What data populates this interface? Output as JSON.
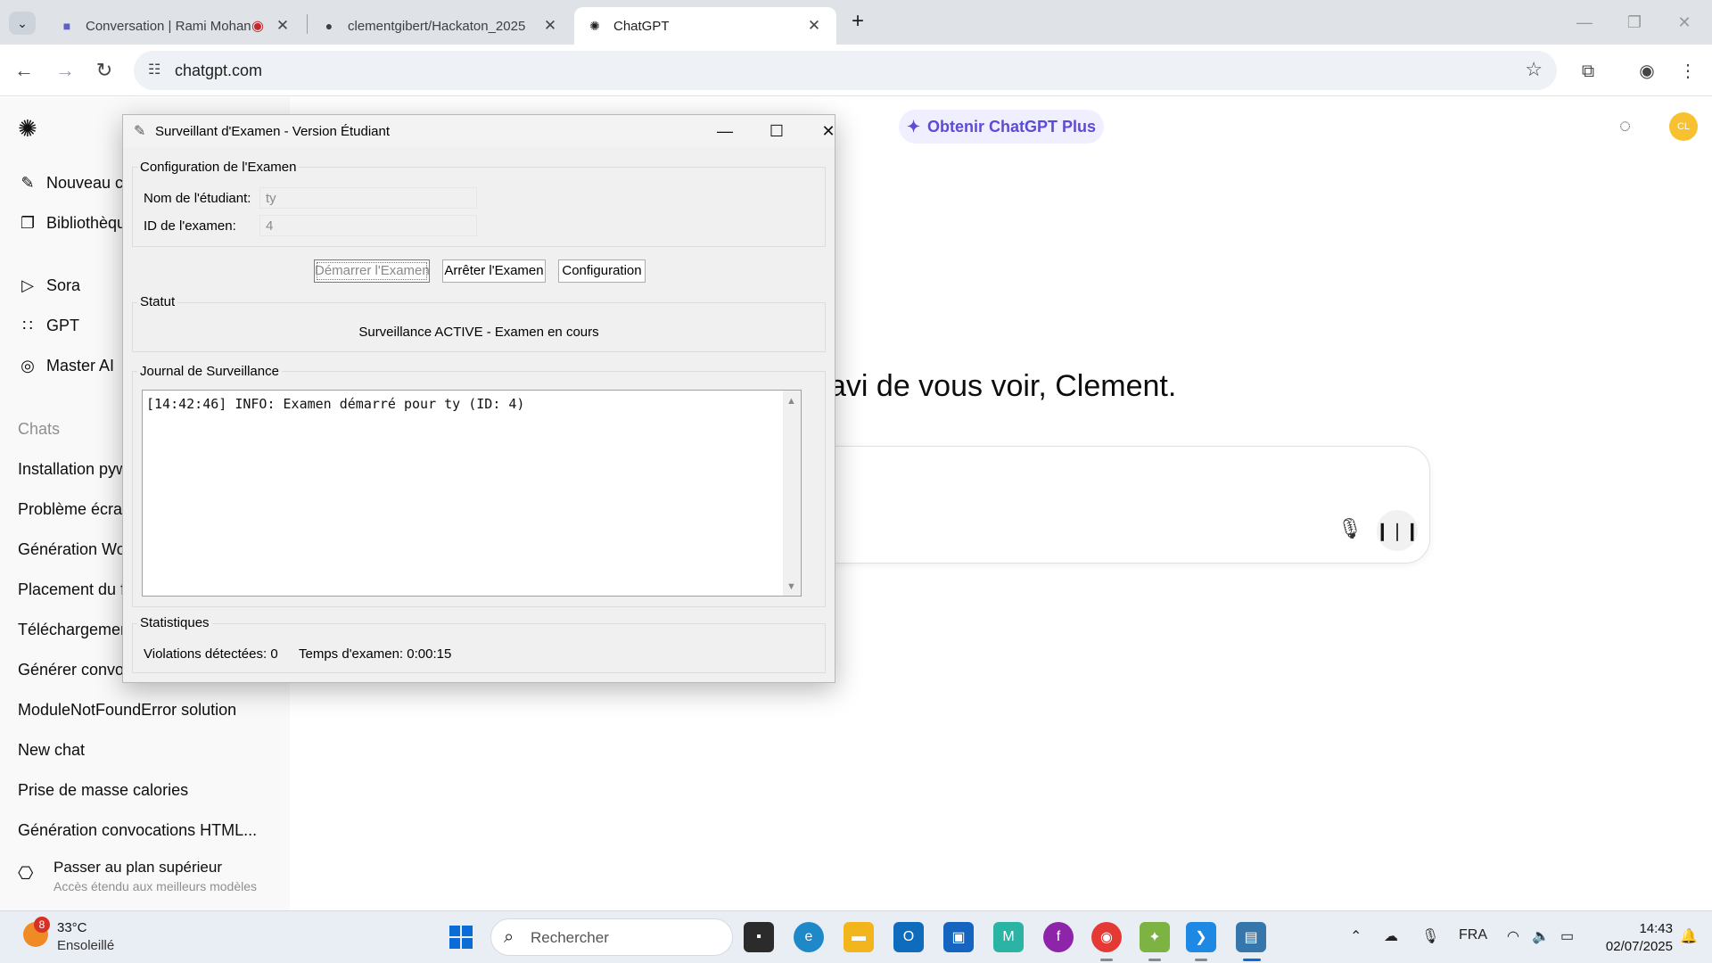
{
  "browser": {
    "tabs": [
      {
        "title": "Conversation | Rami Mohan",
        "icon": "teams-icon"
      },
      {
        "title": "clementgibert/Hackaton_2025",
        "icon": "github-icon"
      },
      {
        "title": "ChatGPT",
        "icon": "openai-icon"
      }
    ],
    "url": "chatgpt.com"
  },
  "sidebar": {
    "nav": [
      {
        "label": "Nouveau c",
        "icon": "edit-icon"
      },
      {
        "label": "Bibliothèqu",
        "icon": "library-icon"
      },
      {
        "label": "Sora",
        "icon": "play-circle-icon"
      },
      {
        "label": "GPT",
        "icon": "grid-icon"
      },
      {
        "label": "Master AI ",
        "icon": "gpt-avatar-icon"
      }
    ],
    "chats_heading": "Chats",
    "chats": [
      "Installation pyw",
      "Problème écran",
      "Génération Wo",
      "Placement du f",
      "Téléchargemen",
      "Générer convo",
      "ModuleNotFoundError solution",
      "New chat",
      "Prise de masse calories",
      "Génération convocations HTML..."
    ],
    "upgrade_title": "Passer au plan supérieur",
    "upgrade_subtitle": "Accès étendu aux meilleurs modèles"
  },
  "main": {
    "plus_button": "Obtenir ChatGPT Plus",
    "avatar_initials": "CL",
    "greeting": "avi de vous voir, Clement."
  },
  "dialog": {
    "title": "Surveillant d'Examen - Version Étudiant",
    "config": {
      "heading": "Configuration de l'Examen",
      "student_label": "Nom de l'étudiant:",
      "student_value": "ty",
      "exam_label": "ID de l'examen:",
      "exam_value": "4"
    },
    "buttons": {
      "start": "Démarrer l'Examen",
      "stop": "Arrêter l'Examen",
      "config": "Configuration"
    },
    "status": {
      "heading": "Statut",
      "text": "Surveillance ACTIVE - Examen en cours"
    },
    "log": {
      "heading": "Journal de Surveillance",
      "text": "[14:42:46] INFO: Examen démarré pour ty (ID: 4)"
    },
    "stats": {
      "heading": "Statistiques",
      "violations": "Violations détectées: 0",
      "time": "Temps d'examen: 0:00:15"
    }
  },
  "taskbar": {
    "weather_badge": "8",
    "temperature": "33°C",
    "condition": "Ensoleillé",
    "search_placeholder": "Rechercher",
    "language": "FRA",
    "time": "14:43",
    "date": "02/07/2025"
  }
}
